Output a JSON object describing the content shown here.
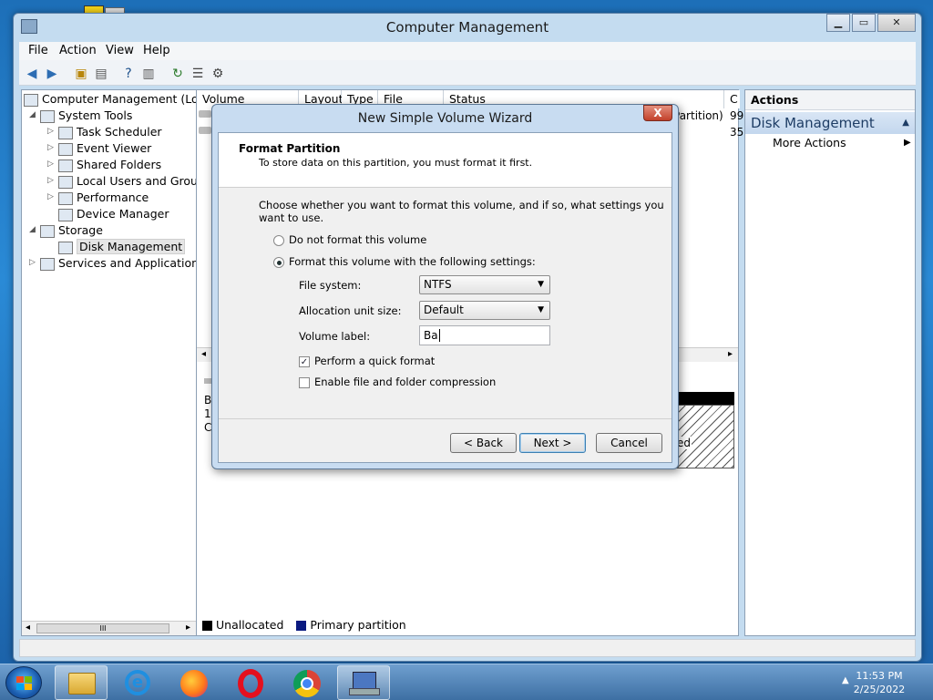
{
  "window": {
    "title": "Computer Management"
  },
  "menu": [
    "File",
    "Action",
    "View",
    "Help"
  ],
  "tree": {
    "root": "Computer Management (Local",
    "system_tools": "System Tools",
    "task_scheduler": "Task Scheduler",
    "event_viewer": "Event Viewer",
    "shared_folders": "Shared Folders",
    "local_users": "Local Users and Groups",
    "performance": "Performance",
    "device_manager": "Device Manager",
    "storage": "Storage",
    "disk_management": "Disk Management",
    "services": "Services and Applications",
    "scroll_thumb": "III"
  },
  "columns": [
    "Volume",
    "Layout",
    "Type",
    "File System",
    "Status",
    "C"
  ],
  "partial": {
    "row1_status": "Partition)",
    "row1_c": "99",
    "row2_c": "35",
    "disk_b": "B",
    "disk_1": "1",
    "disk_c": "C",
    "unalloc_ed": "ed"
  },
  "legend": {
    "unallocated": "Unallocated",
    "primary": "Primary partition"
  },
  "actions": {
    "header": "Actions",
    "section": "Disk Management",
    "more": "More Actions"
  },
  "wizard": {
    "title": "New Simple Volume Wizard",
    "close": "X",
    "header_title": "Format Partition",
    "header_sub": "To store data on this partition, you must format it first.",
    "intro": "Choose whether you want to format this volume, and if so, what settings you want to use.",
    "opt_no_format": "Do not format this volume",
    "opt_format": "Format this volume with the following settings:",
    "fs_label": "File system:",
    "fs_value": "NTFS",
    "alloc_label": "Allocation unit size:",
    "alloc_value": "Default",
    "vol_label": "Volume label:",
    "vol_value": "Ba",
    "quick_format": "Perform a quick format",
    "compression": "Enable file and folder compression",
    "back": "< Back",
    "next": "Next >",
    "cancel": "Cancel"
  },
  "clock": {
    "time": "11:53 PM",
    "date": "2/25/2022"
  }
}
